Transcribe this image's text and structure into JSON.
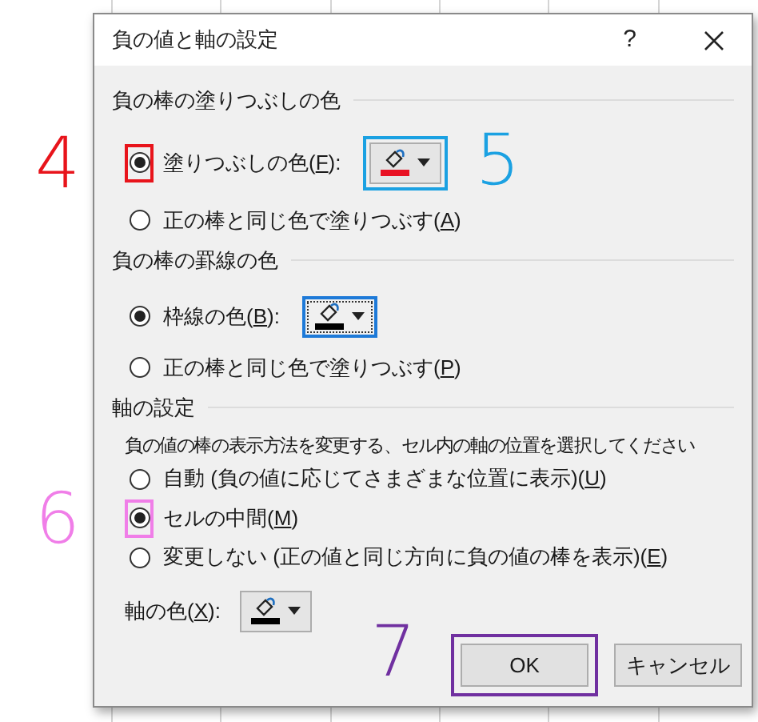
{
  "dialog": {
    "title": "負の値と軸の設定",
    "help_label": "?"
  },
  "sections": [
    {
      "heading": "負の棒の塗りつぶしの色",
      "options": [
        {
          "kind": "radio",
          "selected": true,
          "label": "塗りつぶしの色(",
          "access_key": "F",
          "label_end": "):",
          "callout": {
            "number": "4",
            "color": "#e8141b"
          },
          "swatch": {
            "color": "#e81123",
            "focused": false,
            "callout": {
              "number": "5",
              "color": "#1ba1e2"
            }
          }
        },
        {
          "kind": "radio",
          "selected": false,
          "label": "正の棒と同じ色で塗りつぶす(",
          "access_key": "A",
          "label_end": ")"
        }
      ]
    },
    {
      "heading": "負の棒の罫線の色",
      "options": [
        {
          "kind": "radio",
          "selected": true,
          "label": "枠線の色(",
          "access_key": "B",
          "label_end": "):",
          "swatch": {
            "color": "#000000",
            "focused": true
          }
        },
        {
          "kind": "radio",
          "selected": false,
          "label": "正の棒と同じ色で塗りつぶす(",
          "access_key": "P",
          "label_end": ")"
        }
      ]
    },
    {
      "heading": "軸の設定",
      "description": "負の値の棒の表示方法を変更する、セル内の軸の位置を選択してください",
      "options": [
        {
          "kind": "radio",
          "selected": false,
          "label": "自動 (負の値に応じてさまざまな位置に表示)(",
          "access_key": "U",
          "label_end": ")"
        },
        {
          "kind": "radio",
          "selected": true,
          "label": "セルの中間(",
          "access_key": "M",
          "label_end": ")",
          "callout": {
            "number": "6",
            "color": "#f07ee8"
          }
        },
        {
          "kind": "radio",
          "selected": false,
          "label": "変更しない (正の値と同じ方向に負の値の棒を表示)(",
          "access_key": "E",
          "label_end": ")"
        },
        {
          "kind": "color",
          "label": "軸の色(",
          "access_key": "X",
          "label_end": "):",
          "swatch": {
            "color": "#000000",
            "focused": false
          }
        }
      ]
    }
  ],
  "buttons": [
    {
      "label": "OK",
      "callout": {
        "number": "7",
        "color": "#7030a0"
      }
    },
    {
      "label": "キャンセル"
    }
  ]
}
